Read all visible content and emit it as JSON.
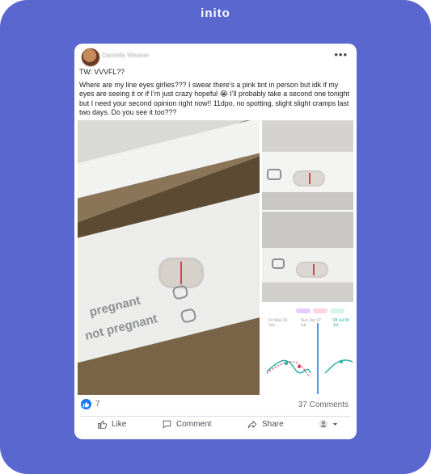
{
  "brand": {
    "logo_text": "inito"
  },
  "post": {
    "author_name": "Danielle Weaver",
    "text_lines": [
      "TW: VVVFL??",
      "Where are my line eyes girlies??? I swear there’s a pink tint in person but idk if my eyes are seeing it or if I’m just crazy hopeful 😭 I’ll probably take a second one tonight but I need your second opinion right now!! 11dpo, no spotting, slight slight cramps last two days. Do you see it too???"
    ],
    "photo_labels": {
      "pregnant": "pregnant",
      "not_pregnant": "not pregnant"
    },
    "photo3": {
      "legend_chips": [
        "",
        "",
        ""
      ],
      "tabs": [
        "Fri May 31 Jun",
        "Sun Jun 07 Jul",
        "08 Jul 09 Jul"
      ]
    },
    "reactions": {
      "count": "7"
    },
    "comments_label": "37 Comments",
    "actions": {
      "like": "Like",
      "comment": "Comment",
      "share": "Share"
    }
  },
  "colors": {
    "frame_bg": "#5a67cf",
    "facebook_blue": "#1877f2",
    "test_line": "#c9484d"
  },
  "icons": {
    "more": "more-dots-icon",
    "like": "thumbs-up-icon",
    "comment": "comment-bubble-icon",
    "share": "share-arrow-icon",
    "audience": "audience-avatar-icon"
  }
}
